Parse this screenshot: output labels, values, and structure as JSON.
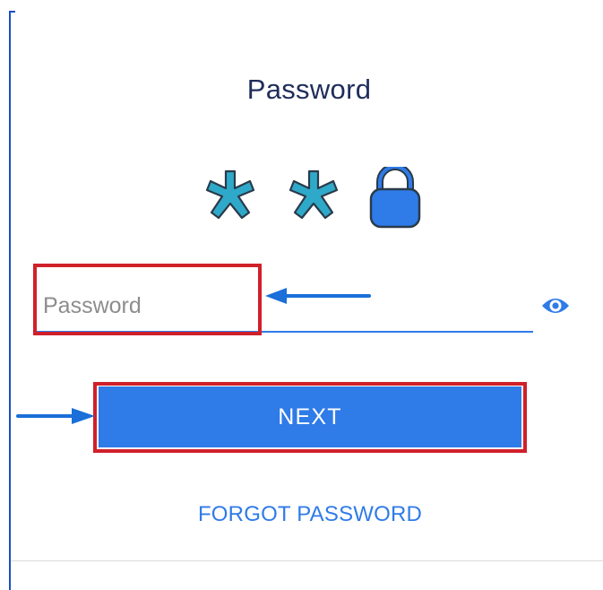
{
  "colors": {
    "accent": "#2f7be8",
    "title_text": "#1f2d5a",
    "annotation_box": "#d0202a",
    "annotation_arrow": "#1a6fd8",
    "asterisk_fill": "#2fa9c9",
    "lock_fill": "#2f7be8"
  },
  "screen": {
    "title": "Password"
  },
  "hero": {
    "icons": [
      "asterisk-icon",
      "asterisk-icon",
      "lock-icon"
    ]
  },
  "password_field": {
    "placeholder": "Password",
    "value": "",
    "visibility_icon": "eye-icon"
  },
  "actions": {
    "next_label": "NEXT",
    "forgot_label": "FORGOT PASSWORD"
  }
}
